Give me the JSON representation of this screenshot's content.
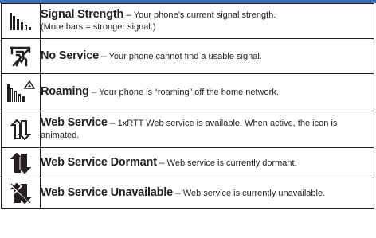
{
  "rows": [
    {
      "icon": "signal-strength-icon",
      "name": "Signal Strength",
      "separator": "–",
      "description": "Your phone’s current signal strength.",
      "description2": "(More bars = stronger signal.)"
    },
    {
      "icon": "no-service-icon",
      "name": "No Service",
      "separator": "–",
      "description": "Your phone cannot find a usable signal."
    },
    {
      "icon": "roaming-icon",
      "name": "Roaming",
      "separator": "–",
      "description": "Your phone is “roaming” off the home network."
    },
    {
      "icon": "web-service-icon",
      "name": "Web Service",
      "separator": "–",
      "description": "1xRTT Web service is available. When active, the icon is animated."
    },
    {
      "icon": "web-service-dormant-icon",
      "name": "Web Service Dormant",
      "separator": "–",
      "description": "Web service is currently dormant."
    },
    {
      "icon": "web-service-unavailable-icon",
      "name": "Web Service Unavailable",
      "separator": "–",
      "description": "Web service is currently unavailable."
    }
  ],
  "colors": {
    "accent_bar": "#3b6fb4",
    "text": "#231f20"
  }
}
